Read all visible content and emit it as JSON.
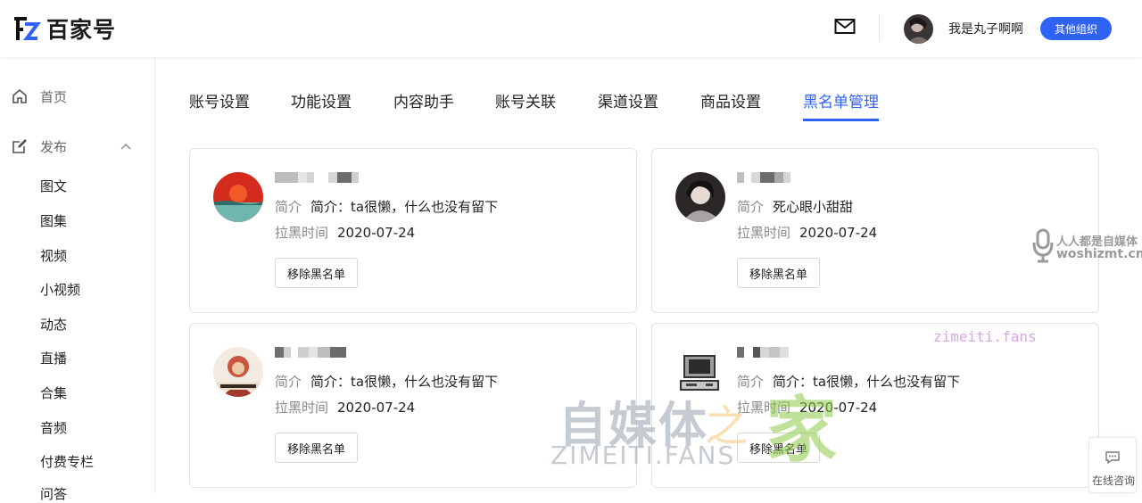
{
  "header": {
    "logo_text": "百家号",
    "username": "我是丸子啊啊",
    "org_button": "其他组织",
    "icons": {
      "logo": "baijiahao-logo-icon",
      "mail": "mail-icon",
      "avatar": "user-avatar"
    }
  },
  "sidebar": {
    "home": "首页",
    "publish": "发布",
    "publish_items": [
      "图文",
      "图集",
      "视频",
      "小视频",
      "动态",
      "直播",
      "合集",
      "音频",
      "付费专栏",
      "问答"
    ],
    "icons": {
      "home": "home-icon",
      "publish": "edit-icon",
      "toggle": "chevron-up-icon"
    }
  },
  "tabs": [
    "账号设置",
    "功能设置",
    "内容助手",
    "账号关联",
    "渠道设置",
    "商品设置",
    "黑名单管理"
  ],
  "active_tab": "黑名单管理",
  "labels": {
    "intro": "简介",
    "blocked_time": "拉黑时间",
    "remove_button": "移除黑名单"
  },
  "blacklist": [
    {
      "intro": "简介：ta很懒，什么也没有留下",
      "time": "2020-07-24"
    },
    {
      "intro": "死心眼小甜甜",
      "time": "2020-07-24"
    },
    {
      "intro": "简介：ta很懒，什么也没有留下",
      "time": "2020-07-24"
    },
    {
      "intro": "简介：ta很懒，什么也没有留下",
      "time": "2020-07-24"
    }
  ],
  "watermarks": {
    "right_line1": "人人都是自媒体",
    "right_line2": "woshizmt.cn",
    "fans": "zimeiti.fans",
    "big_a": "自媒体",
    "big_zhi": "之",
    "big_jia": "家",
    "big_sub": "ZIMEITI.FANS"
  },
  "online": {
    "text": "在线咨询"
  },
  "colors": {
    "accent": "#2e63f6",
    "muted": "#888888",
    "border": "#e4e4e4"
  }
}
